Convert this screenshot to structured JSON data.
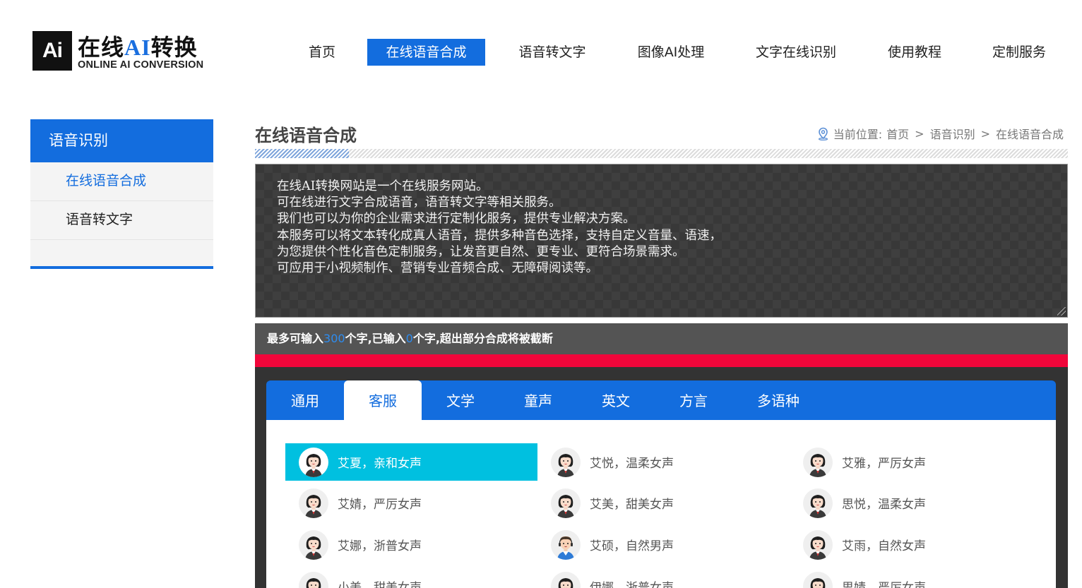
{
  "logo": {
    "box_text": "Ai",
    "cn_prefix": "在线",
    "cn_ai": "AI",
    "cn_suffix": "转换",
    "en": "ONLINE AI CONVERSION"
  },
  "nav": {
    "items": [
      {
        "label": "首页"
      },
      {
        "label": "在线语音合成",
        "active": true
      },
      {
        "label": "语音转文字"
      },
      {
        "label": "图像AI处理"
      },
      {
        "label": "文字在线识别"
      },
      {
        "label": "使用教程"
      },
      {
        "label": "定制服务"
      }
    ]
  },
  "sidebar": {
    "title": "语音识别",
    "items": [
      {
        "label": "在线语音合成",
        "active": true
      },
      {
        "label": "语音转文字"
      }
    ]
  },
  "main": {
    "title": "在线语音合成",
    "breadcrumb": {
      "prefix": "当前位置:",
      "items": [
        "首页",
        "语音识别",
        "在线语音合成"
      ],
      "separator": ">"
    }
  },
  "editor": {
    "lines": [
      "在线AI转换网站是一个在线服务网站。",
      "可在线进行文字合成语音，语音转文字等相关服务。",
      "我们也可以为你的企业需求进行定制化服务，提供专业解决方案。",
      "本服务可以将文本转化成真人语音，提供多种音色选择，支持自定义音量、语速，",
      "为您提供个性化音色定制服务，让发音更自然、更专业、更符合场景需求。",
      "可应用于小视频制作、营销专业音频合成、无障碍阅读等。"
    ]
  },
  "counter": {
    "part1": "最多可输入",
    "max": "300",
    "part2": "个字,已输入",
    "count": "0",
    "part3": "个字,超出部分合成将被截断"
  },
  "voice_tabs": [
    {
      "label": "通用"
    },
    {
      "label": "客服",
      "active": true
    },
    {
      "label": "文学"
    },
    {
      "label": "童声"
    },
    {
      "label": "英文"
    },
    {
      "label": "方言"
    },
    {
      "label": "多语种"
    }
  ],
  "voices": [
    {
      "name": "艾夏，亲和女声",
      "avatar": "female-avatar-icon",
      "active": true
    },
    {
      "name": "艾悦，温柔女声",
      "avatar": "female-avatar-icon"
    },
    {
      "name": "艾雅，严厉女声",
      "avatar": "female-avatar-icon"
    },
    {
      "name": "艾婧，严厉女声",
      "avatar": "female-avatar-icon"
    },
    {
      "name": "艾美，甜美女声",
      "avatar": "female-avatar-icon"
    },
    {
      "name": "思悦，温柔女声",
      "avatar": "female-avatar-icon"
    },
    {
      "name": "艾娜，浙普女声",
      "avatar": "female-avatar-icon"
    },
    {
      "name": "艾硕，自然男声",
      "avatar": "male-avatar-icon"
    },
    {
      "name": "艾雨，自然女声",
      "avatar": "female-avatar-icon"
    },
    {
      "name": "小美，甜美女声",
      "avatar": "female-avatar-icon"
    },
    {
      "name": "伊娜，浙普女声",
      "avatar": "female-avatar-icon"
    },
    {
      "name": "思婧，严厉女声",
      "avatar": "female-avatar-icon"
    }
  ],
  "colors": {
    "primary": "#136dde",
    "highlight": "#00c0e0",
    "danger": "#f0063a",
    "dark": "#333333"
  }
}
